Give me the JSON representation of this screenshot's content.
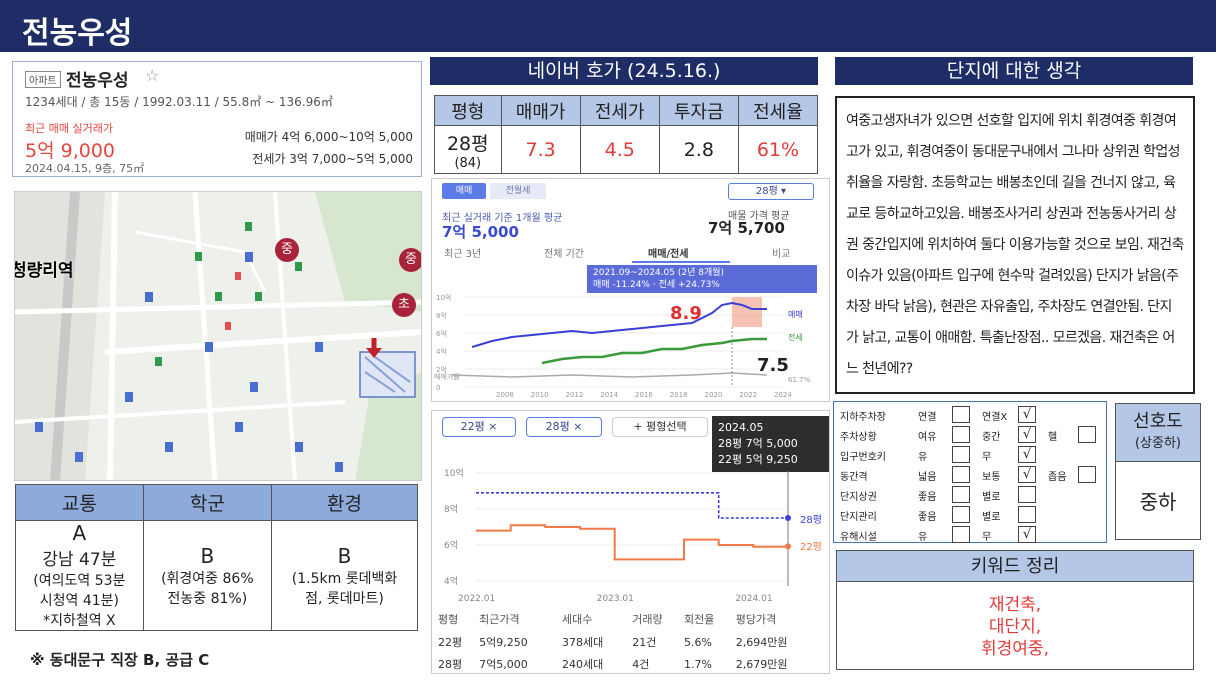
{
  "page_title": "전농우성",
  "summary": {
    "tag": "아파트",
    "name": "전농우성",
    "info": "1234세대 / 총 15동 / 1992.03.11 / 55.8㎡ ~ 136.96㎡",
    "recent_label": "최근 매매 실거래가",
    "recent_price": "5억 9,000",
    "recent_date": "2024.04.15, 9층, 75㎡",
    "sale_range": "매매가 4억 6,000~10억 5,000",
    "jeonse_range": "전세가 3억 7,000~5억 5,000"
  },
  "map": {
    "station_label": "청량리역",
    "school_markers": [
      "중",
      "중",
      "초"
    ]
  },
  "eval": {
    "headers": [
      "교통",
      "학군",
      "환경"
    ],
    "traffic": [
      "A",
      "강남 47분",
      "(여의도역 53분",
      "시청역 41분)",
      "*지하철역 X"
    ],
    "school": [
      "B",
      "(휘경여중 86%",
      "전농중 81%)"
    ],
    "env": [
      "B",
      "(1.5km 롯데백화",
      "점, 롯데마트)"
    ]
  },
  "footnote": "※ 동대문구 직장 B, 공급 C",
  "naver": {
    "header": "네이버 호가 (24.5.16.)",
    "columns": [
      "평형",
      "매매가",
      "전세가",
      "투자금",
      "전세율"
    ],
    "row": {
      "pyeong": "28평",
      "sub": "(84)",
      "sale": "7.3",
      "jeonse": "4.5",
      "invest": "2.8",
      "ratio": "61%"
    }
  },
  "chart1": {
    "tab_sale": "매매",
    "tab_jeonse": "전월세",
    "size_select": "28평",
    "left_caption": "최근 실거래 기준 1개월 평균",
    "left_value": "7억 5,000",
    "right_caption": "매물 가격 평균",
    "right_value": "7억 5,700",
    "subtabs": [
      "최근 3년",
      "전체 기간",
      "매매/전세",
      "비교"
    ],
    "tooltip_line1": "2021.09~2024.05 (2년 8개월)",
    "tooltip_line2": "매매 -11.24% · 전세 +24.73%",
    "annot_high": "8.9",
    "annot_low": "7.5",
    "legend_sale": "매매",
    "legend_jeonse": "전세",
    "yticks": [
      "10억",
      "8억",
      "6억",
      "4억",
      "2억",
      "0"
    ],
    "xticks": [
      "2008",
      "2010",
      "2012",
      "2014",
      "2016",
      "2018",
      "2020",
      "2022",
      "2024"
    ],
    "ratio_label": "매매가율",
    "ratio_value": "61.7%"
  },
  "chart_data": {
    "type": "line",
    "title": "",
    "x": [
      "2022.01",
      "2022.04",
      "2022.07",
      "2022.10",
      "2023.01",
      "2023.04",
      "2023.07",
      "2023.10",
      "2024.01",
      "2024.05"
    ],
    "series": [
      {
        "name": "28평",
        "values": [
          8.9,
          8.9,
          8.9,
          8.9,
          8.9,
          8.9,
          8.9,
          7.5,
          7.5,
          7.5
        ]
      },
      {
        "name": "22평",
        "values": [
          6.8,
          7.1,
          7.0,
          6.9,
          5.2,
          5.2,
          6.3,
          6.0,
          5.9,
          5.925
        ]
      }
    ],
    "ylim": [
      4,
      10
    ],
    "yticks": [
      "10억",
      "8억",
      "6억",
      "4억"
    ],
    "xticks": [
      "2022.01",
      "2023.01",
      "2024.01"
    ]
  },
  "chart2": {
    "chip1": "22평 ×",
    "chip2": "28평 ×",
    "add": "+ 평형선택",
    "tip_date": "2024.05",
    "tip_28": "28평 7억 5,000",
    "tip_22": "22평 5억 9,250",
    "legend_28": "28평",
    "legend_22": "22평",
    "table_headers": [
      "평형",
      "최근가격",
      "세대수",
      "거래량",
      "회전율",
      "평당가격"
    ],
    "rows": [
      [
        "22평",
        "5억9,250",
        "378세대",
        "21건",
        "5.6%",
        "2,694만원"
      ],
      [
        "28평",
        "7억5,000",
        "240세대",
        "4건",
        "1.7%",
        "2,679만원"
      ]
    ]
  },
  "thoughts": {
    "header": "단지에 대한 생각",
    "text": "여중고생자녀가 있으면 선호할 입지에 위치 휘경여중 휘경여고가 있고, 휘경여중이 동대문구내에서 그나마 상위권 학업성취율을 자랑함. 초등학교는 배봉초인데 길을 건너지 않고, 육교로 등하교하고있음. 배봉조사거리 상권과 전농동사거리 상권 중간입지에 위치하여 둘다 이용가능할 것으로 보임. 재건축이슈가 있음(아파트 입구에 현수막 걸려있음) 단지가 낡음(주차장 바닥 낡음), 현관은 자유출입, 주차장도 연결안됨. 단지가 낡고, 교통이 애매함. 특출난장점.. 모르겠음. 재건축은 어느 천년에??"
  },
  "checklist": {
    "rows": [
      {
        "label": "지하주차장",
        "opts": [
          "연결",
          "연결X"
        ],
        "checked": [
          false,
          true
        ]
      },
      {
        "label": "주차상황",
        "opts": [
          "여유",
          "중간",
          "헬"
        ],
        "checked": [
          false,
          true,
          false
        ]
      },
      {
        "label": "입구번호키",
        "opts": [
          "유",
          "무"
        ],
        "checked": [
          false,
          true
        ]
      },
      {
        "label": "동간격",
        "opts": [
          "넓음",
          "보통",
          "좁음"
        ],
        "checked": [
          false,
          true,
          false
        ]
      },
      {
        "label": "단지상권",
        "opts": [
          "좋음",
          "별로"
        ],
        "checked": [
          false,
          false
        ]
      },
      {
        "label": "단지관리",
        "opts": [
          "좋음",
          "별로"
        ],
        "checked": [
          false,
          false
        ]
      },
      {
        "label": "유해시설",
        "opts": [
          "유",
          "무"
        ],
        "checked": [
          false,
          true
        ]
      }
    ]
  },
  "preference": {
    "title": "선호도",
    "subtitle": "(상중하)",
    "value": "중하"
  },
  "keywords": {
    "header": "키워드 정리",
    "items": [
      "재건축,",
      "대단지,",
      "휘경여중,"
    ]
  },
  "colors": {
    "navy": "#1f2d66",
    "header_blue": "#b4c7e7",
    "red": "#e03a3a",
    "blue_line": "#3a3fd8",
    "green_line": "#3a9a3a",
    "orange_line": "#f07a4a"
  }
}
